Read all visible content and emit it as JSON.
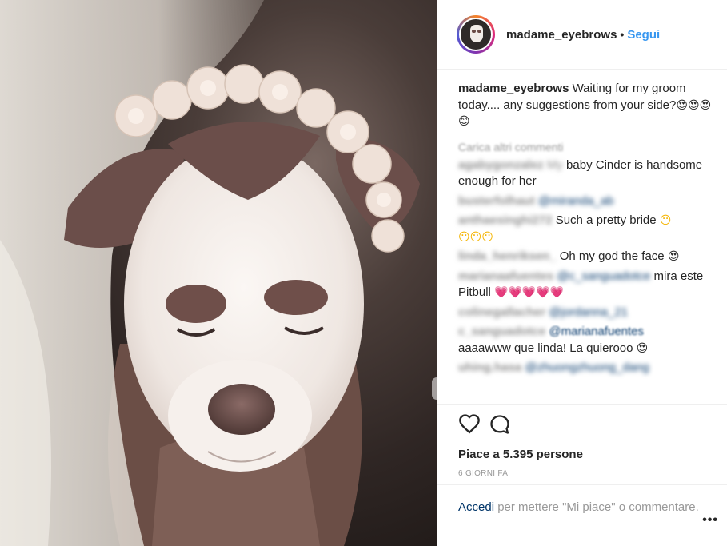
{
  "post": {
    "author": "madame_eyebrows",
    "separator": "•",
    "follow_label": "Segui",
    "caption_user": "madame_eyebrows",
    "caption_text": " Waiting for my groom today.... any suggestions from your side?",
    "caption_emojis": "😍😍😍😊",
    "load_more": "Carica altri commenti"
  },
  "comments": [
    {
      "user": "agabygonzalez",
      "text_plain": "My ",
      "text_after": "baby Cinder is handsome enough for her",
      "user_blurred": true
    },
    {
      "user": "busterfolhaut",
      "mention": "@miranda_ab",
      "text_plain": "",
      "user_blurred": true,
      "mention_blurred": true
    },
    {
      "user": "anthaesinghi272",
      "text_plain": " Such a pretty bride ",
      "emoji": "😶",
      "emoji2": "😶😶😶",
      "user_blurred": true
    },
    {
      "user": "linda_henriksen_",
      "text_plain": " Oh my god the face ",
      "emoji": "😍",
      "user_blurred": true
    },
    {
      "user": "marianaafuentes",
      "mention": "@c_sanguadotce",
      "text_plain": " mira este Pitbull ",
      "emoji": "💗💗💗💗💗",
      "user_blurred": true,
      "mention_blurred": true
    },
    {
      "user": "colinegallacher",
      "mention": "@jordanna_21",
      "text_plain": "",
      "user_blurred": true,
      "mention_blurred": true
    },
    {
      "user": "c_sanguadotce",
      "mention": "@marianafuentes",
      "text_plain": " aaaawww que linda! La quierooo ",
      "emoji": "😍",
      "user_blurred": true
    },
    {
      "user": "uhing.hasa",
      "mention": "@zhuongzhuong_dang",
      "text_plain": "",
      "user_blurred": true,
      "mention_blurred": true
    }
  ],
  "actions": {
    "likes_text": "Piace a 5.395 persone",
    "time_text": "6 GIORNI FA"
  },
  "footer": {
    "login_label": "Accedi",
    "login_rest": " per mettere \"Mi piace\" o commentare.",
    "more_label": "•••"
  },
  "colors": {
    "link": "#3897f0",
    "dark_link": "#003569",
    "muted": "#999999",
    "border": "#efefef"
  },
  "icons": [
    "heart-icon",
    "comment-icon",
    "more-icon"
  ]
}
